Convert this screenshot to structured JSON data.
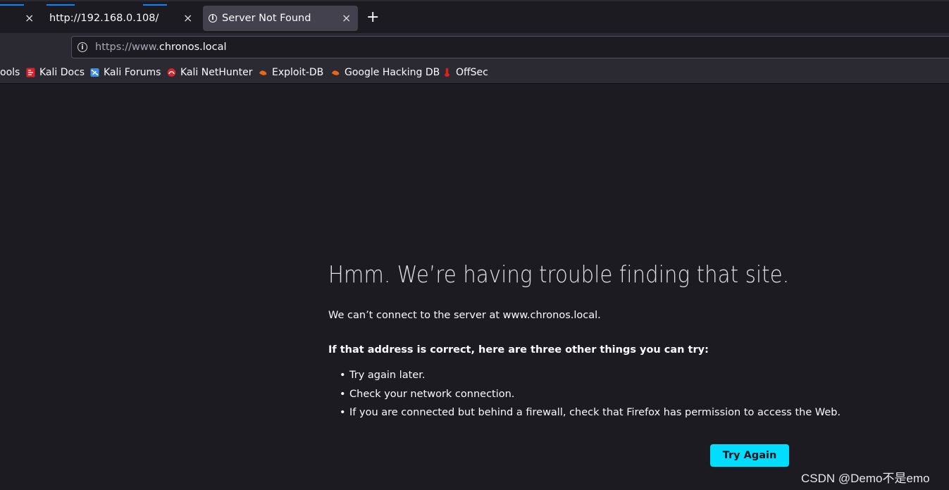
{
  "tabs": [
    {
      "title": "",
      "close": "×",
      "selected": false
    },
    {
      "title": "http://192.168.0.108/",
      "close": "×",
      "selected": false
    },
    {
      "title": "Server Not Found",
      "close": "×",
      "selected": true,
      "icon": "info-icon"
    }
  ],
  "new_tab_glyph": "+",
  "urlbar": {
    "prefix": "https://www.",
    "host": "chronos.local",
    "icon": "info-icon"
  },
  "bookmarks": [
    {
      "label": "ools",
      "icon": "none"
    },
    {
      "label": "Kali Docs",
      "icon": "kali-docs-icon",
      "color": "#e0202a"
    },
    {
      "label": "Kali Forums",
      "icon": "kali-forums-icon",
      "color": "#3d8fe0"
    },
    {
      "label": "Kali NetHunter",
      "icon": "kali-nethunter-icon",
      "color": "#e0202a"
    },
    {
      "label": "Exploit-DB",
      "icon": "exploit-db-icon",
      "color": "#e8651a"
    },
    {
      "label": "Google Hacking DB",
      "icon": "ghdb-icon",
      "color": "#e8651a"
    },
    {
      "label": "OffSec",
      "icon": "offsec-icon",
      "color": "#d8201c"
    }
  ],
  "error": {
    "title": "Hmm. We’re having trouble finding that site.",
    "short_desc": "We can’t connect to the server at www.chronos.local.",
    "suggest_title": "If that address is correct, here are three other things you can try:",
    "suggestions": [
      "Try again later.",
      "Check your network connection.",
      "If you are connected but behind a firewall, check that Firefox has permission to access the Web."
    ],
    "try_again_label": "Try Again"
  },
  "watermark": "CSDN @Demo不是emo",
  "colors": {
    "accent_button": "#00ddff",
    "tab_highlight": "#0a84ff",
    "page_bg": "#1c1b22"
  }
}
